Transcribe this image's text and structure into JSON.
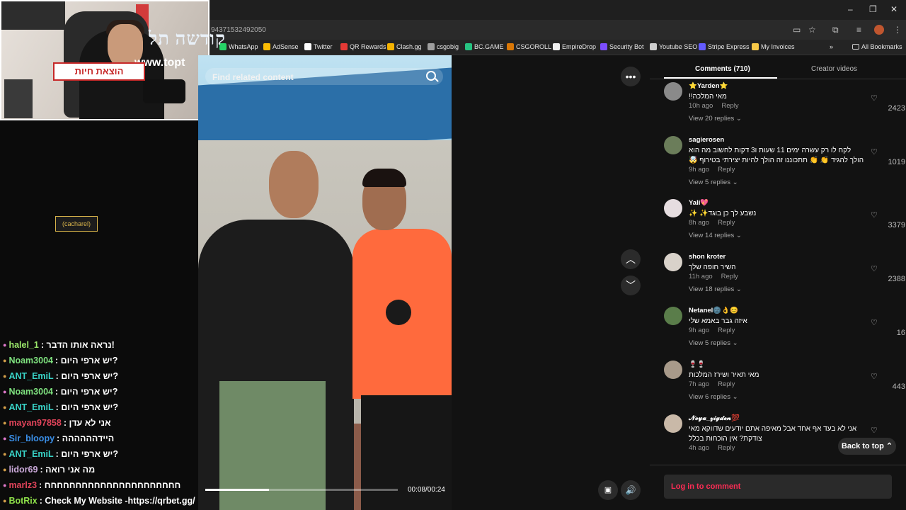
{
  "browser": {
    "url": "94371532492050",
    "bookmarks": [
      {
        "label": "WhatsApp",
        "icon": "whatsapp-icon",
        "color": "#25d366"
      },
      {
        "label": "AdSense",
        "icon": "adsense-icon",
        "color": "#fbbc04"
      },
      {
        "label": "Twitter",
        "icon": "twitter-icon",
        "color": "#ffffff"
      },
      {
        "label": "QR Rewards",
        "icon": "qr-rewards-icon",
        "color": "#e53935"
      },
      {
        "label": "Clash.gg",
        "icon": "clash-icon",
        "color": "#f5b301"
      },
      {
        "label": "csgobig",
        "icon": "csgobig-icon",
        "color": "#9e9e9e"
      },
      {
        "label": "BC.GAME",
        "icon": "bcgame-icon",
        "color": "#26c281"
      },
      {
        "label": "CSGOROLL",
        "icon": "csgoroll-icon",
        "color": "#d97706"
      },
      {
        "label": "EmpireDrop",
        "icon": "empiredrop-icon",
        "color": "#eeeeee"
      },
      {
        "label": "Security Bot",
        "icon": "security-bot-icon",
        "color": "#7c4dff"
      },
      {
        "label": "Youtube SEO",
        "icon": "youtube-seo-icon",
        "color": "#cccccc"
      },
      {
        "label": "Stripe Express",
        "icon": "stripe-icon",
        "color": "#635bff"
      },
      {
        "label": "My Invoices",
        "icon": "invoices-icon",
        "color": "#f7c948"
      }
    ],
    "all_bookmarks": "All Bookmarks"
  },
  "chat": [
    {
      "user": "halel_1",
      "text": ": נראה אותו הדבר!",
      "color": "#9be86b"
    },
    {
      "user": "Noam3004",
      "text": ": יש ארפי היום?",
      "color": "#7fe27f"
    },
    {
      "user": "ANT_EmiL",
      "text": ": יש ארפי היום?",
      "color": "#39d4c8"
    },
    {
      "user": "Noam3004",
      "text": ": יש ארפי היום?",
      "color": "#7fe27f"
    },
    {
      "user": "ANT_EmiL",
      "text": ": יש ארפי היום?",
      "color": "#39d4c8"
    },
    {
      "user": "mayan97858",
      "text": ": אני לא עדן",
      "color": "#e0445a"
    },
    {
      "user": "Sir_bloopy",
      "text": ": היידהההההה",
      "color": "#3a8ee6"
    },
    {
      "user": "ANT_EmiL",
      "text": ": יש ארפי היום?",
      "color": "#39d4c8"
    },
    {
      "user": "lidor69",
      "text": ": מה אני רואה",
      "color": "#c9a8d8"
    },
    {
      "user": "marlz3",
      "text": ": חחחחחחחחחחחחחחחחחחחחחח",
      "color": "#e0445a"
    },
    {
      "user": "BotRix",
      "text": ": Check My Website -https://qrbet.gg/",
      "color": "#8fe24a"
    }
  ],
  "video": {
    "search_placeholder": "Find related content",
    "time": "00:08/00:24",
    "progress": 0.33,
    "sign_text": "קודשה תל",
    "sign_url": "www.topt",
    "sign_red": "הוצאת חיות",
    "shirt_logo": "(cacharel)"
  },
  "comments_panel": {
    "tab_comments": "Comments (710)",
    "tab_creator": "Creator videos",
    "reply_label": "Reply",
    "back_to_top": "Back to top",
    "login": "Log in to comment",
    "comments": [
      {
        "user": "⭐Yarden⭐",
        "text": "מאי המלכה!!",
        "time": "10h ago",
        "views": "View 20 replies",
        "likes": "2423",
        "avatar": "#8a8a8a"
      },
      {
        "user": "sagierosen",
        "text": "לקח לו רק עשרה ימים 11 שעות ו3 דקות לחשוב מה הוא הולך להגיד 👏 👏 תתכוננו זה הולך להיות יצירתי בטירוף 🤯",
        "time": "9h ago",
        "views": "View 5 replies",
        "likes": "1019",
        "avatar": "#6b7d5a"
      },
      {
        "user": "Yali💖",
        "text": "נשבע לך כן בוגד✨ ✨",
        "time": "8h ago",
        "views": "View 14 replies",
        "likes": "3379",
        "avatar": "#e6dde0"
      },
      {
        "user": "shon kroter",
        "text": "השיר חופה שלך",
        "time": "11h ago",
        "views": "View 18 replies",
        "likes": "2388",
        "avatar": "#d9d2ca"
      },
      {
        "user": "Netanel🌚👌😊",
        "text": "איזה גבר באמא שלי",
        "time": "9h ago",
        "views": "View 5 replies",
        "likes": "16",
        "avatar": "#5a7d4a"
      },
      {
        "user": "🍷🍷",
        "text": "מאי תאיר ושירז המלכות",
        "time": "7h ago",
        "views": "View 6 replies",
        "likes": "443",
        "avatar": "#a89a8a"
      },
      {
        "user": "𝓝𝓸𝔂𝓪_𝔃𝓲𝓰𝓭𝓮𝓷💯",
        "text": "אני לא בעד אף אחד אבל מאיפה אתם יודעים שדווקא מאי צודקת? אין הוכחות בכלל",
        "time": "4h ago",
        "views": "",
        "likes": "",
        "avatar": "#c9b9a8"
      }
    ]
  }
}
